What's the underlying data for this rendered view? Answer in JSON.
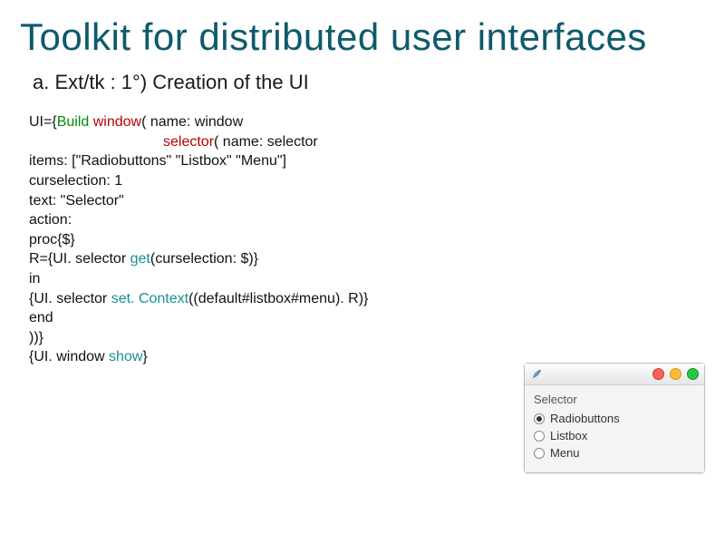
{
  "title": "Toolkit for distributed user interfaces",
  "subtitle": "a. Ext/tk : 1°) Creation of the UI",
  "code": {
    "l1_a": "UI={",
    "l1_b": "Build",
    "l1_c": " ",
    "l1_d": "window",
    "l1_e": "( name: window",
    "l2_a": "selector",
    "l2_b": "( name: selector",
    "l3": "items: [\"Radiobuttons\" \"Listbox\" \"Menu\"]",
    "l4": "curselection: 1",
    "l5": "text: \"Selector\"",
    "l6": "action:",
    "l7": "proc{$}",
    "l8_a": "R={UI. selector ",
    "l8_b": "get",
    "l8_c": "(curselection: $)}",
    "l9": "in",
    "l10_a": "{UI. selector ",
    "l10_b": "set. Context",
    "l10_c": "((default#listbox#menu). R)}",
    "l11": "end",
    "l12": "))}",
    "l13_a": "{UI. window ",
    "l13_b": "show",
    "l13_c": "}"
  },
  "preview": {
    "label": "Selector",
    "options": [
      "Radiobuttons",
      "Listbox",
      "Menu"
    ],
    "selected_index": 0
  }
}
